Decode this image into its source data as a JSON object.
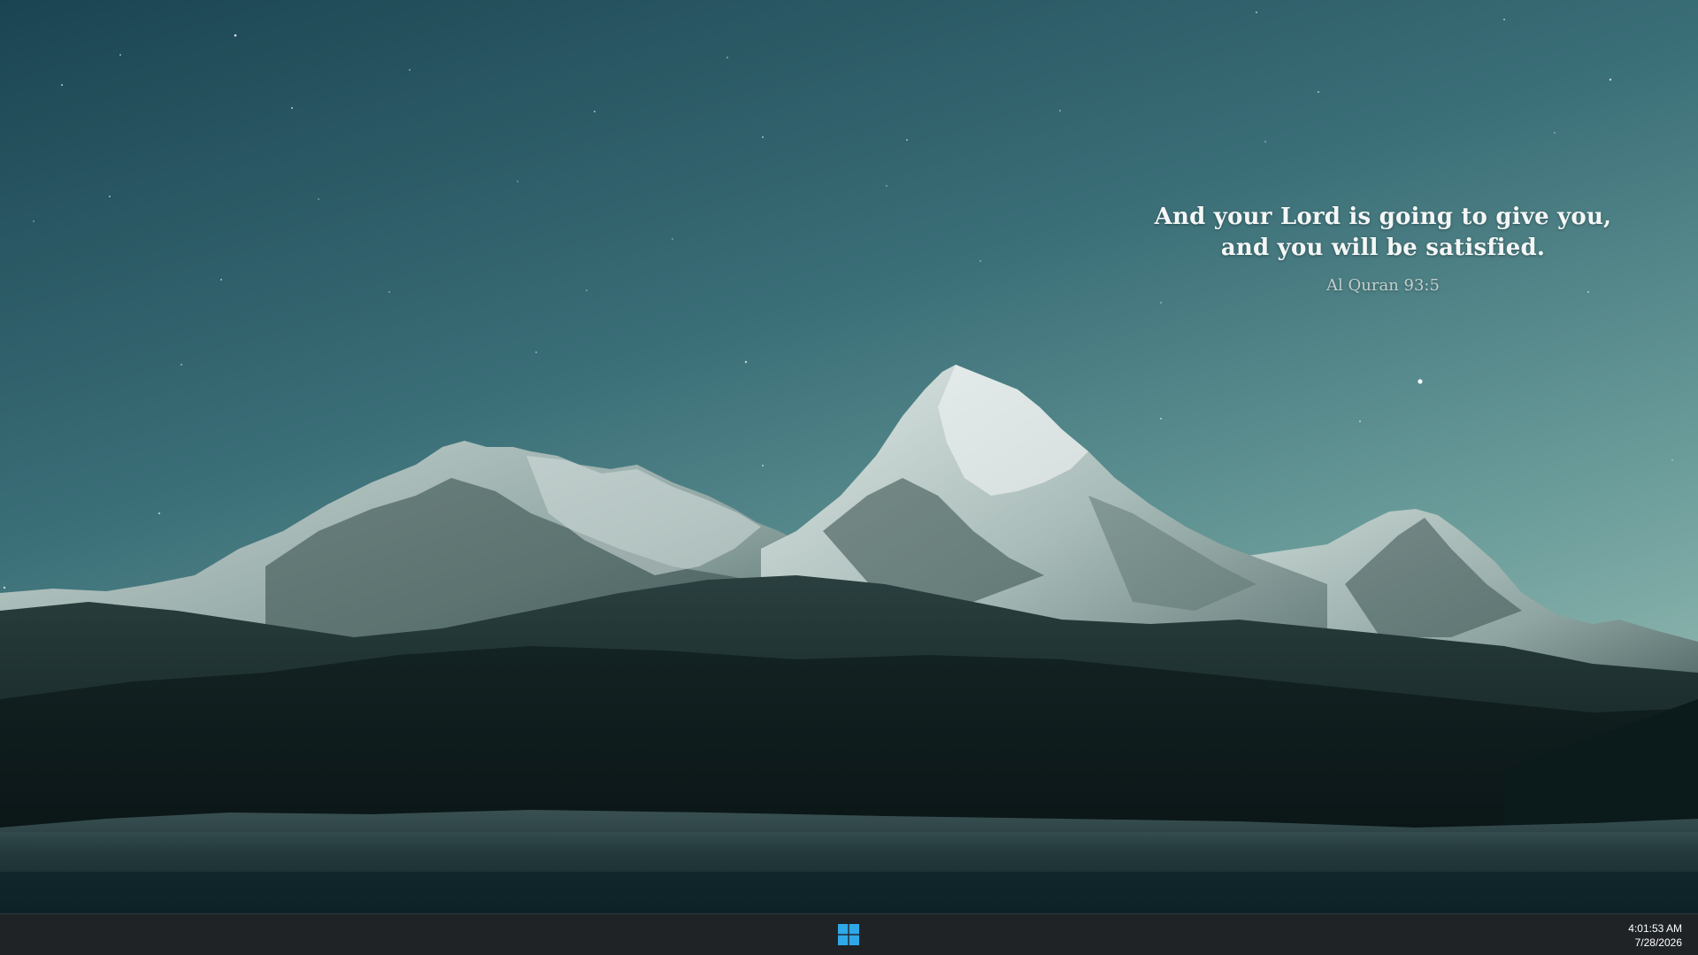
{
  "wallpaper": {
    "description_icon": "mountain-night-wallpaper"
  },
  "quote": {
    "line1": "And your Lord is going to give you,",
    "line2": "and you will be satisfied.",
    "reference": "Al Quran 93:5"
  },
  "taskbar": {
    "start_icon": "windows-logo-icon",
    "accent_color": "#2fa8e8",
    "time": "4:01:53 AM",
    "date": "7/28/2026"
  }
}
